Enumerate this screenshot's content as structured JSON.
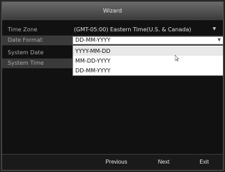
{
  "window": {
    "title": "Wizard"
  },
  "form": {
    "time_zone": {
      "label": "Time Zone",
      "value": "(GMT-05:00) Eastern Time(U.S. & Canada)"
    },
    "date_format": {
      "label": "Date Format",
      "value": "DD-MM-YYYY",
      "options": [
        "YYYY-MM-DD",
        "MM-DD-YYYY",
        "DD-MM-YYYY"
      ]
    },
    "system_date": {
      "label": "System Date"
    },
    "system_time": {
      "label": "System Time"
    }
  },
  "footer": {
    "previous": "Previous",
    "next": "Next",
    "exit": "Exit"
  },
  "colors": {
    "background": "#111111",
    "band": "#3a3a3a",
    "text": "#a9a9a9"
  }
}
